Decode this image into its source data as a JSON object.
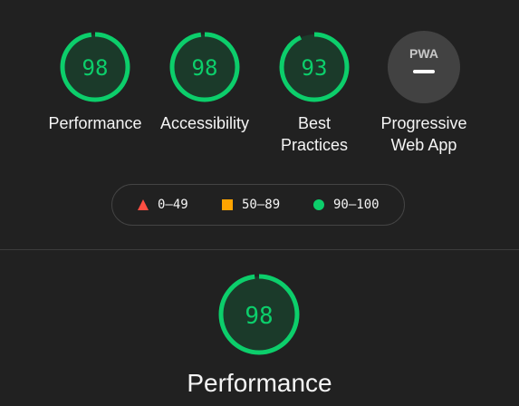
{
  "colors": {
    "pass": "#0cce6b",
    "pass_fill": "#1b3a2a",
    "average": "#ffa400",
    "fail": "#ff4e42",
    "pwa_bg": "#424242",
    "background": "#212121"
  },
  "categories": [
    {
      "label": "Performance",
      "score": 98
    },
    {
      "label": "Accessibility",
      "score": 98
    },
    {
      "label": "Best Practices",
      "score": 93
    },
    {
      "label": "Progressive Web App",
      "score": null,
      "badge": "PWA",
      "icon": "pwa-icon"
    }
  ],
  "legend": [
    {
      "range": "0–49",
      "icon": "triangle-icon"
    },
    {
      "range": "50–89",
      "icon": "square-icon"
    },
    {
      "range": "90–100",
      "icon": "circle-icon"
    }
  ],
  "featured": {
    "label": "Performance",
    "score": 98
  }
}
